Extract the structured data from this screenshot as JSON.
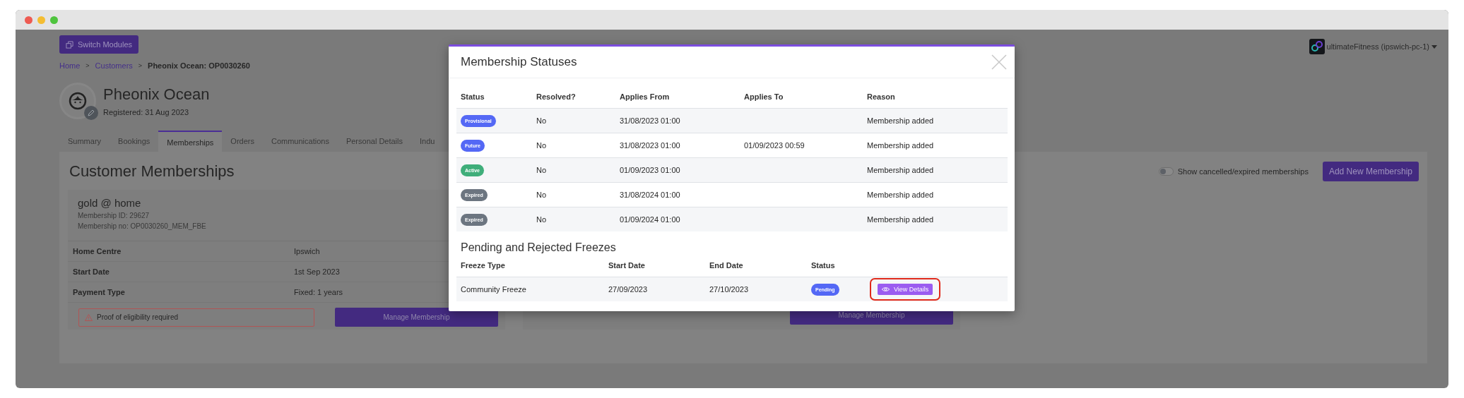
{
  "top_bar": {
    "switch_button": "Switch Modules",
    "account": "ultimateFitness (ipswich-pc-1)"
  },
  "breadcrumb": {
    "separator": ">",
    "items": [
      {
        "label": "Home",
        "link": true
      },
      {
        "label": "Customers",
        "link": true
      },
      {
        "label": "Pheonix Ocean: OP0030260",
        "link": false
      }
    ]
  },
  "customer": {
    "name": "Pheonix Ocean",
    "registered": "Registered: 31 Aug 2023"
  },
  "tabs": [
    {
      "label": "Summary",
      "selected": false
    },
    {
      "label": "Bookings",
      "selected": false
    },
    {
      "label": "Memberships",
      "selected": true
    },
    {
      "label": "Orders",
      "selected": false
    },
    {
      "label": "Communications",
      "selected": false
    },
    {
      "label": "Personal Details",
      "selected": false
    },
    {
      "label": "Indu",
      "selected": false
    }
  ],
  "section": {
    "title": "Customer Memberships",
    "toggle": {
      "label": "Show cancelled/expired memberships",
      "on": false
    },
    "add_button": "Add New Membership"
  },
  "memberships": [
    {
      "name": "gold @ home",
      "id": "Membership ID: 29627",
      "number": "Membership no: OP0030260_MEM_FBE",
      "details": [
        {
          "label": "Home Centre",
          "value": "Ipswich"
        },
        {
          "label": "Start Date",
          "value": "1st Sep 2023"
        },
        {
          "label": "Payment Type",
          "value": "Fixed: 1 years"
        }
      ],
      "warning": "Proof of eligibility required",
      "manage_button": "Manage Membership"
    },
    {
      "manage_button": "Manage Membership"
    }
  ],
  "modal": {
    "title": "Membership Statuses",
    "columns": [
      "Status",
      "Resolved?",
      "Applies From",
      "Applies To",
      "Reason"
    ],
    "rows": [
      {
        "status": "Provisional",
        "color": "#5468f5",
        "resolved": "No",
        "from": "31/08/2023 01:00",
        "to": "",
        "reason": "Membership added"
      },
      {
        "status": "Future",
        "color": "#5468f5",
        "resolved": "No",
        "from": "31/08/2023 01:00",
        "to": "01/09/2023 00:59",
        "reason": "Membership added"
      },
      {
        "status": "Active",
        "color": "#3fae7a",
        "resolved": "No",
        "from": "01/09/2023 01:00",
        "to": "",
        "reason": "Membership added"
      },
      {
        "status": "Expired",
        "color": "#6c7580",
        "resolved": "No",
        "from": "31/08/2024 01:00",
        "to": "",
        "reason": "Membership added"
      },
      {
        "status": "Expired",
        "color": "#6c7580",
        "resolved": "No",
        "from": "01/09/2024 01:00",
        "to": "",
        "reason": "Membership added"
      }
    ],
    "freezes": {
      "title": "Pending and Rejected Freezes",
      "columns": [
        "Freeze Type",
        "Start Date",
        "End Date",
        "Status"
      ],
      "rows": [
        {
          "type": "Community Freeze",
          "start": "27/09/2023",
          "end": "27/10/2023",
          "status": "Pending",
          "color": "#5468f5",
          "action": "View Details",
          "highlighted": true
        }
      ]
    }
  }
}
